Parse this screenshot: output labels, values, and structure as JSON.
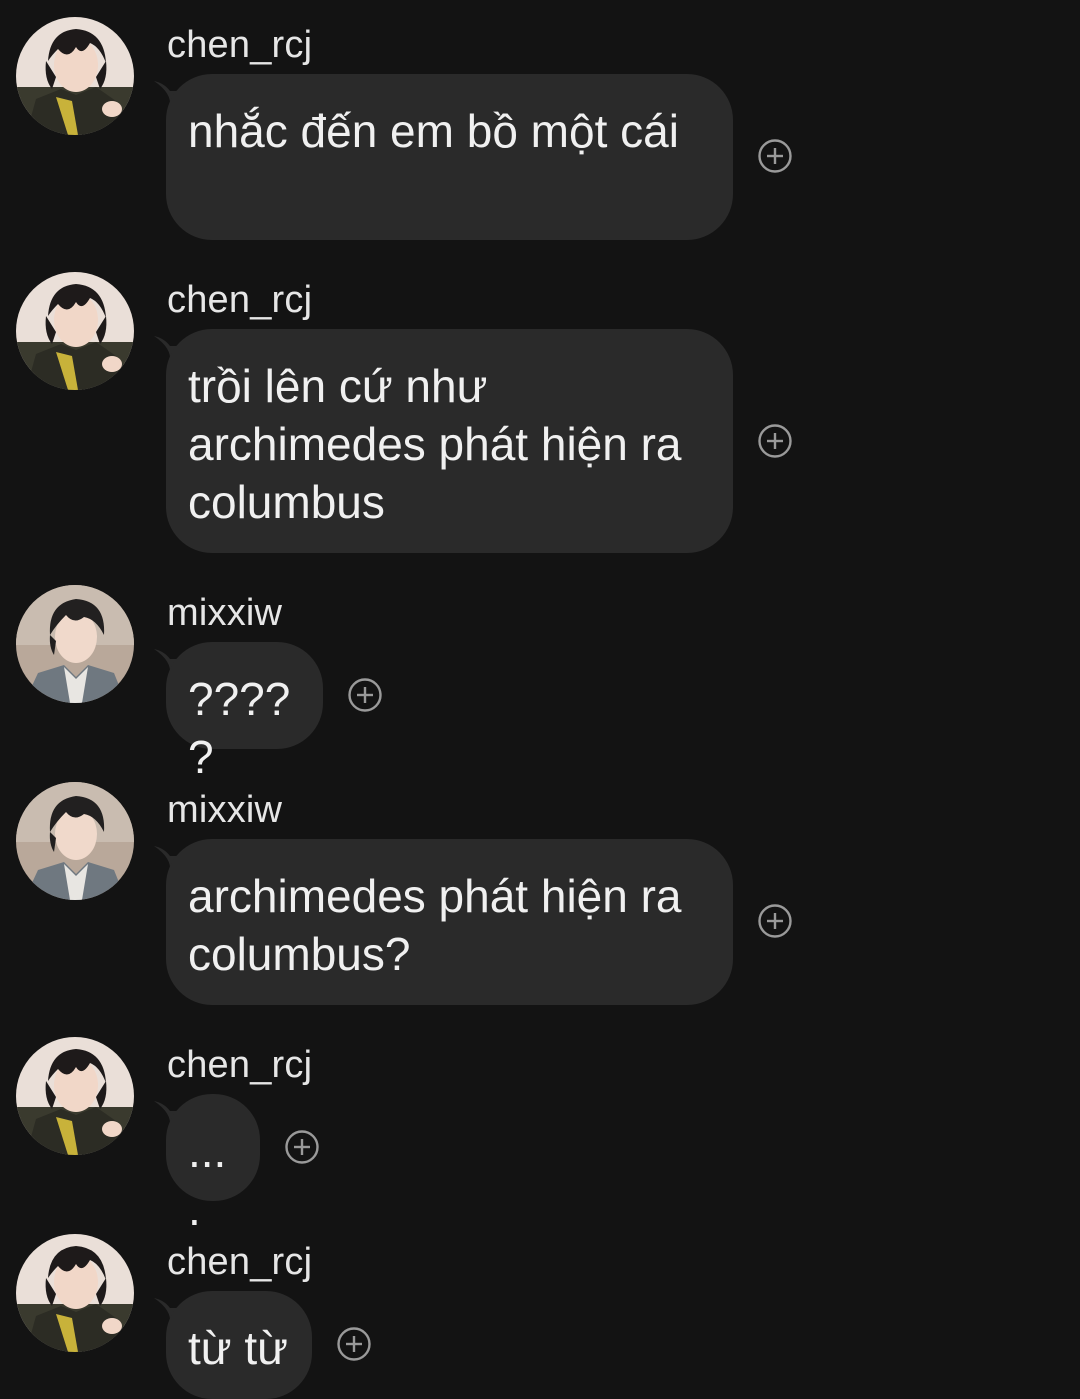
{
  "colors": {
    "background": "#131313",
    "bubble": "#2a2a2a",
    "text": "#f0f0f0",
    "icon": "#9a9a9a"
  },
  "messages": [
    {
      "username": "chen_rcj",
      "avatar": "avatar-chen",
      "text": "nhắc đến em bồ một cái",
      "reaction_icon": "add-reaction-icon"
    },
    {
      "username": "chen_rcj",
      "avatar": "avatar-chen",
      "text": "trồi lên cứ như archimedes phát hiện ra columbus",
      "reaction_icon": "add-reaction-icon"
    },
    {
      "username": "mixxiw",
      "avatar": "avatar-mixxiw",
      "text": "?????",
      "reaction_icon": "add-reaction-icon"
    },
    {
      "username": "mixxiw",
      "avatar": "avatar-mixxiw",
      "text": "archimedes phát hiện ra columbus?",
      "reaction_icon": "add-reaction-icon"
    },
    {
      "username": "chen_rcj",
      "avatar": "avatar-chen",
      "text": "....",
      "reaction_icon": "add-reaction-icon"
    },
    {
      "username": "chen_rcj",
      "avatar": "avatar-chen",
      "text": "từ từ",
      "reaction_icon": "add-reaction-icon"
    }
  ]
}
